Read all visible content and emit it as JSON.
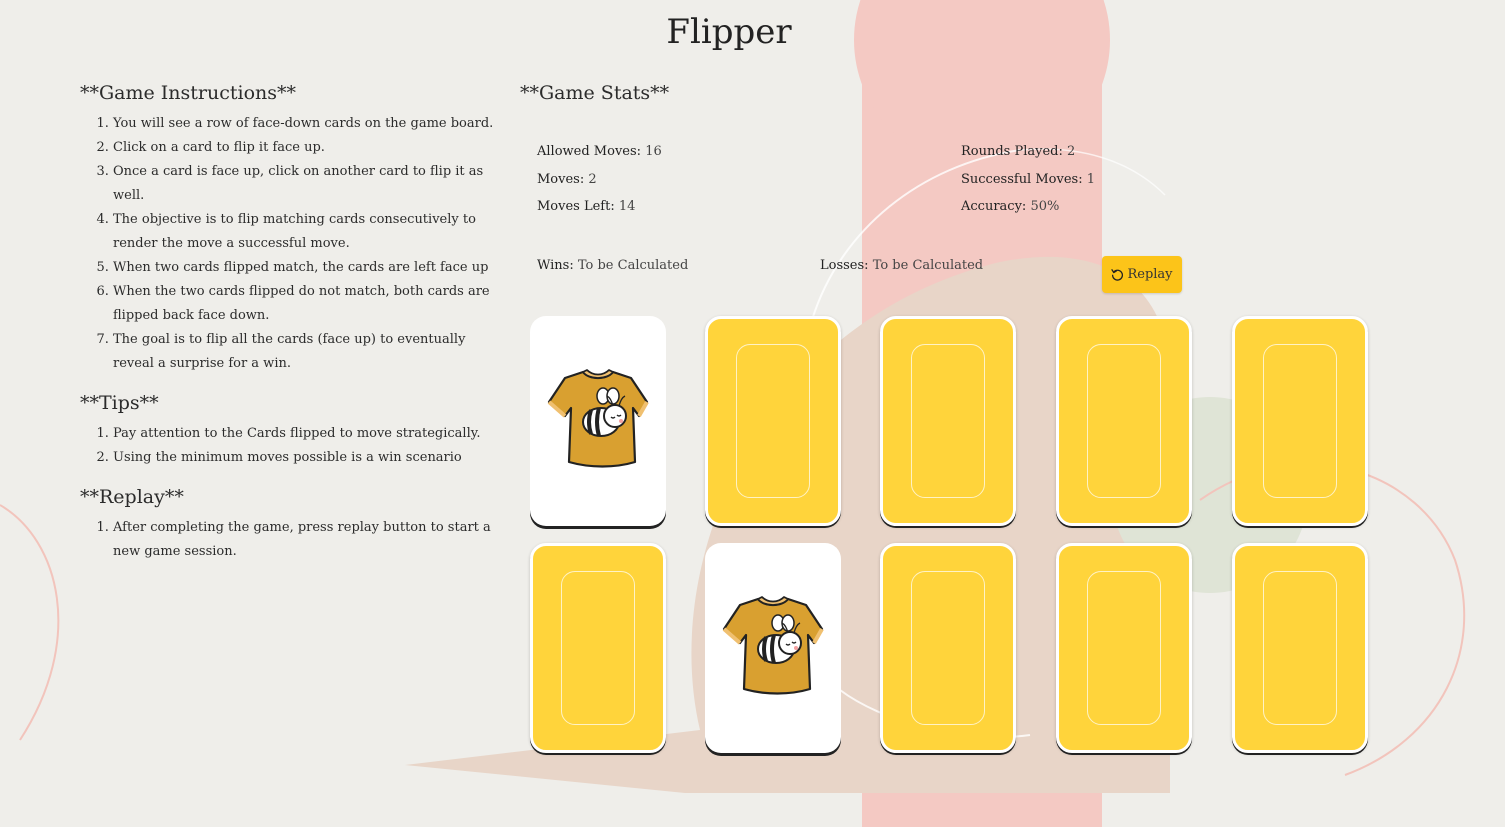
{
  "title": "Flipper",
  "instructions": {
    "heading": "**Game Instructions**",
    "items": [
      "You will see a row of face-down cards on the game board.",
      "Click on a card to flip it face up.",
      "Once a card is face up, click on another card to flip it as well.",
      "The objective is to flip matching cards consecutively to render the move a successful move.",
      "When two cards flipped match, the cards are left face up",
      "When the two cards flipped do not match, both cards are flipped back face down.",
      "The goal is to flip all the cards (face up) to eventually reveal a surprise for a win."
    ]
  },
  "tips": {
    "heading": "**Tips**",
    "items": [
      "Pay attention to the Cards flipped to move strategically.",
      "Using the minimum moves possible is a win scenario"
    ]
  },
  "replay_section": {
    "heading": "**Replay**",
    "items": [
      "After completing the game, press replay button to start a new game session."
    ]
  },
  "stats": {
    "heading": "**Game Stats**",
    "allowed_moves_label": "Allowed Moves:",
    "allowed_moves": "16",
    "moves_label": "Moves:",
    "moves": "2",
    "moves_left_label": "Moves Left:",
    "moves_left": "14",
    "rounds_played_label": "Rounds Played:",
    "rounds_played": "2",
    "successful_moves_label": "Successful Moves:",
    "successful_moves": "1",
    "accuracy_label": "Accuracy:",
    "accuracy": "50%",
    "wins_label": "Wins:",
    "wins": "To be Calculated",
    "losses_label": "Losses:",
    "losses": "To be Calculated",
    "replay_label": "Replay"
  },
  "board": {
    "cards": [
      {
        "face": "up",
        "image": "bee-shirt-icon"
      },
      {
        "face": "down"
      },
      {
        "face": "down"
      },
      {
        "face": "down"
      },
      {
        "face": "down"
      },
      {
        "face": "down"
      },
      {
        "face": "up",
        "image": "bee-shirt-icon"
      },
      {
        "face": "down"
      },
      {
        "face": "down"
      },
      {
        "face": "down"
      }
    ]
  },
  "colors": {
    "background": "#efeeea",
    "card_back": "#ffd43b",
    "button": "#fcc419",
    "blob_pink": "#f4c9c3",
    "blob_beige": "#e8d5c8"
  }
}
